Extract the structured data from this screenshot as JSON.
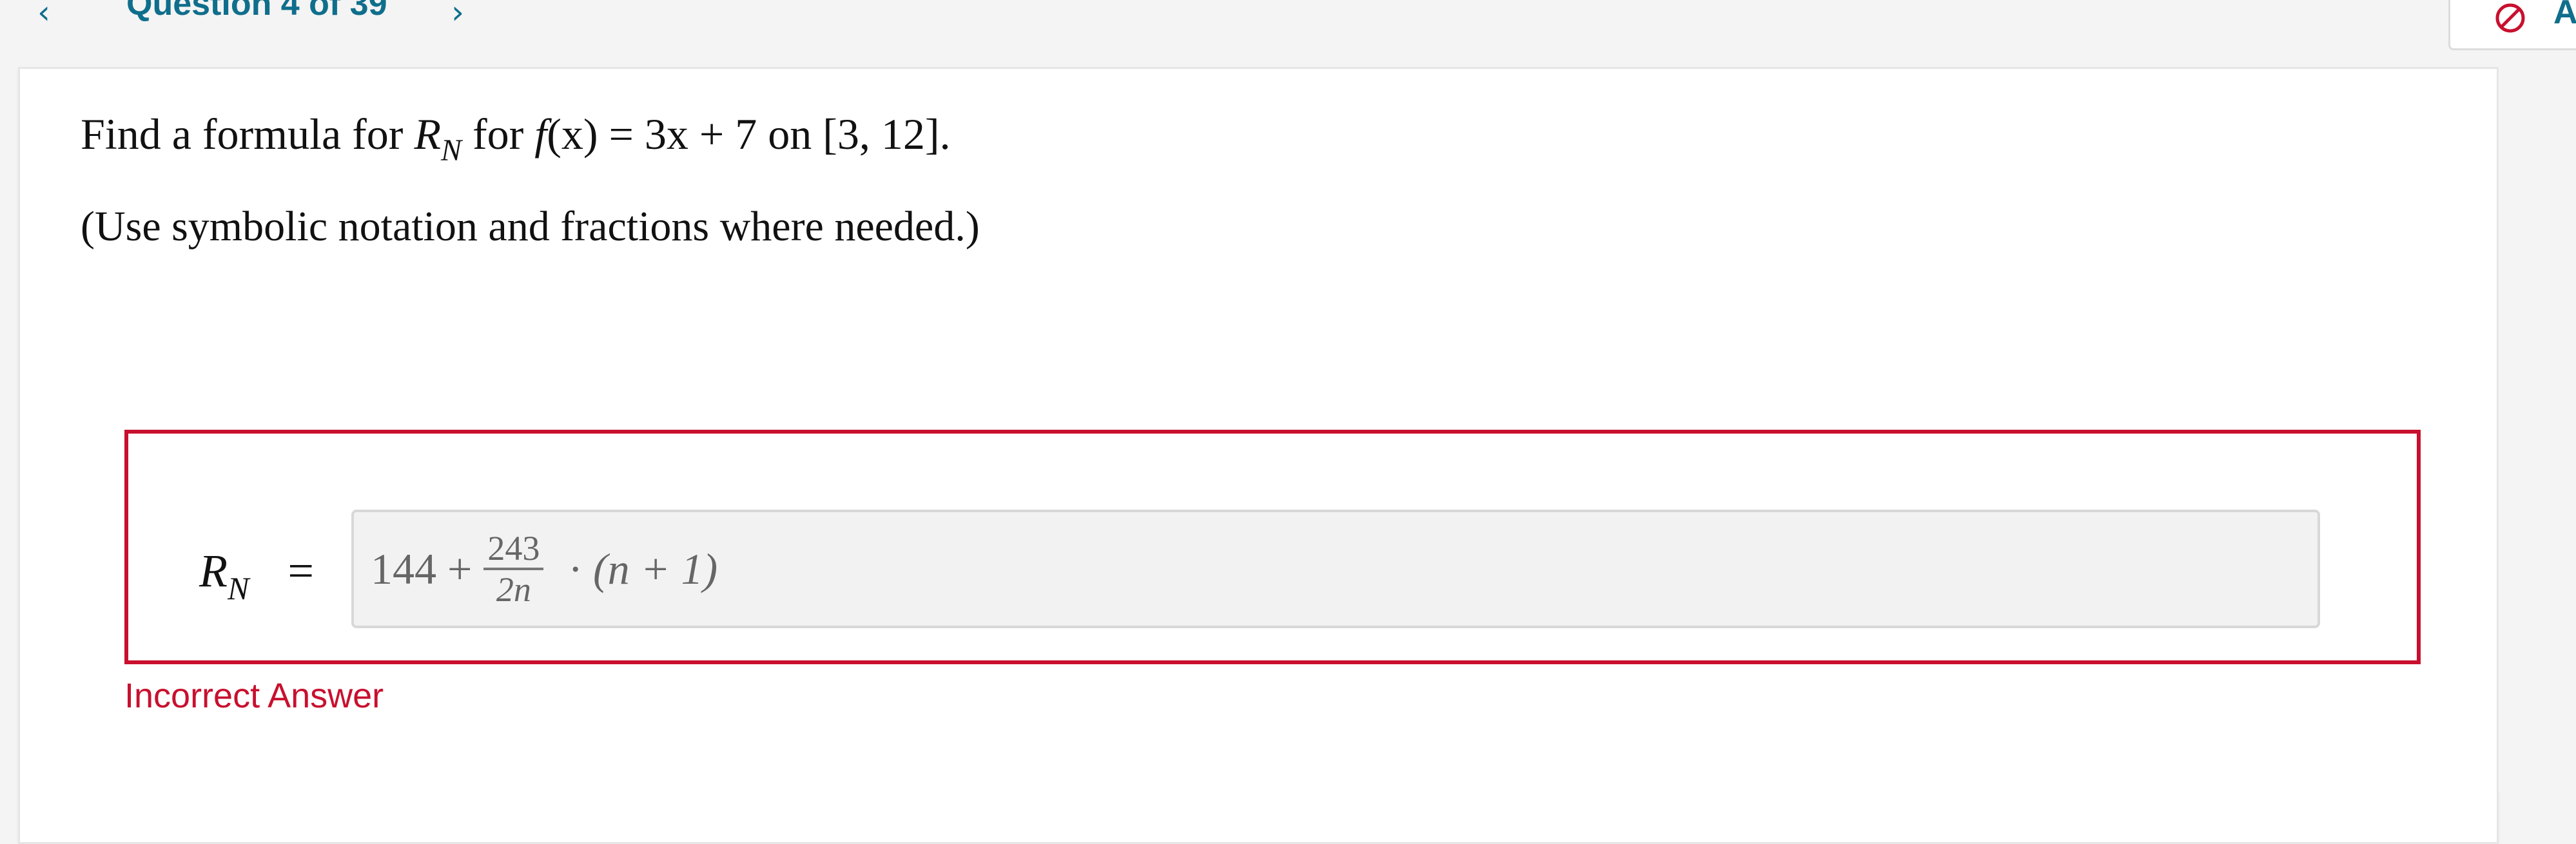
{
  "header": {
    "question_counter": "Question 4 of 39",
    "prev_icon": "chevron-left-icon",
    "next_icon": "chevron-right-icon",
    "prev_glyph": "‹",
    "next_glyph": "›",
    "top_right_icon": "ban-icon",
    "top_right_label": "A",
    "accent_color": "#0f6e8c"
  },
  "question": {
    "prompt_prefix": "Find a formula for ",
    "prompt_var": "R",
    "prompt_var_sub": "N",
    "prompt_mid": " for ",
    "prompt_func": "f",
    "prompt_func_rest": "(x) = 3x + 7",
    "prompt_suffix": " on [3, 12].",
    "instruction": "(Use symbolic notation and fractions where needed.)"
  },
  "answer": {
    "label_var": "R",
    "label_sub": "N",
    "label_eq": "=",
    "expr_lead": "144 +",
    "frac_num": "243",
    "frac_den": "2n",
    "expr_dot": "·",
    "expr_tail": "(n + 1)",
    "status_color": "#c8102e"
  },
  "feedback": {
    "text": "Incorrect Answer"
  }
}
